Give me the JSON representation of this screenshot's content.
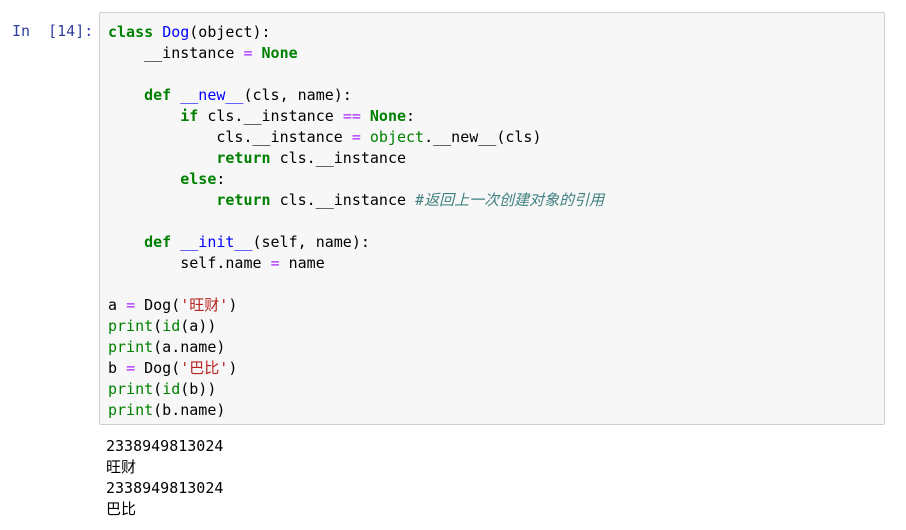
{
  "cell": {
    "prompt": "In  [14]:",
    "code_lines": [
      "class Dog(object):",
      "    __instance = None",
      "",
      "    def __new__(cls, name):",
      "        if cls.__instance == None:",
      "            cls.__instance = object.__new__(cls)",
      "            return cls.__instance",
      "        else:",
      "            return cls.__instance #返回上一次创建对象的引用",
      "",
      "    def __init__(self, name):",
      "        self.name = name",
      "",
      "a = Dog('旺财')",
      "print(id(a))",
      "print(a.name)",
      "b = Dog('巴比')",
      "print(id(b))",
      "print(b.name)"
    ],
    "output_lines": [
      "2338949813024",
      "旺财",
      "2338949813024",
      "巴比"
    ]
  },
  "colors": {
    "prompt": "#303f9f",
    "keyword": "#008000",
    "name": "#0000ff",
    "operator": "#aa22ff",
    "string": "#ba2121",
    "comment": "#408080",
    "cell_background": "#f7f7f7",
    "cell_border": "#cfcfcf"
  }
}
